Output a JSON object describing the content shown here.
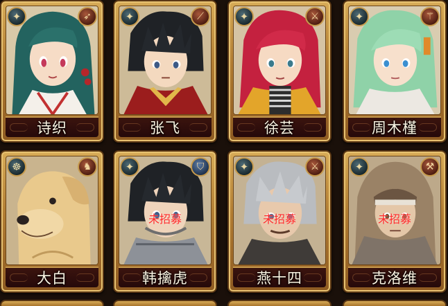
{
  "roster": [
    {
      "name": "诗织",
      "status": "",
      "class_icon": "winged-crest-icon",
      "weapon_icon": "bow-icon",
      "portrait": "teal-hair-girl"
    },
    {
      "name": "张飞",
      "status": "",
      "class_icon": "winged-crest-icon",
      "weapon_icon": "spear-icon",
      "portrait": "black-hair-boy"
    },
    {
      "name": "徐芸",
      "status": "",
      "class_icon": "winged-crest-icon",
      "weapon_icon": "sword-icon",
      "portrait": "red-hair-girl"
    },
    {
      "name": "周木槿",
      "status": "",
      "class_icon": "winged-crest-icon",
      "weapon_icon": "staff-icon",
      "portrait": "mint-hair-girl"
    },
    {
      "name": "大白",
      "status": "",
      "class_icon": "beast-crest-icon",
      "weapon_icon": "fang-icon",
      "portrait": "yellow-dog"
    },
    {
      "name": "韩擒虎",
      "status": "未招募",
      "class_icon": "winged-crest-icon",
      "weapon_icon": "shield-icon",
      "portrait": "armored-boy"
    },
    {
      "name": "燕十四",
      "status": "未招募",
      "class_icon": "winged-crest-icon",
      "weapon_icon": "sword-icon",
      "portrait": "grey-hair-man"
    },
    {
      "name": "克洛维",
      "status": "未招募",
      "class_icon": "winged-crest-icon",
      "weapon_icon": "axe-icon",
      "portrait": "hooded-man"
    }
  ],
  "colors": {
    "status_text": "#ff2a2a",
    "card_gold": "#b27d33",
    "nameplate": "#2e0f0c",
    "name_text": "#fbf5e3"
  }
}
